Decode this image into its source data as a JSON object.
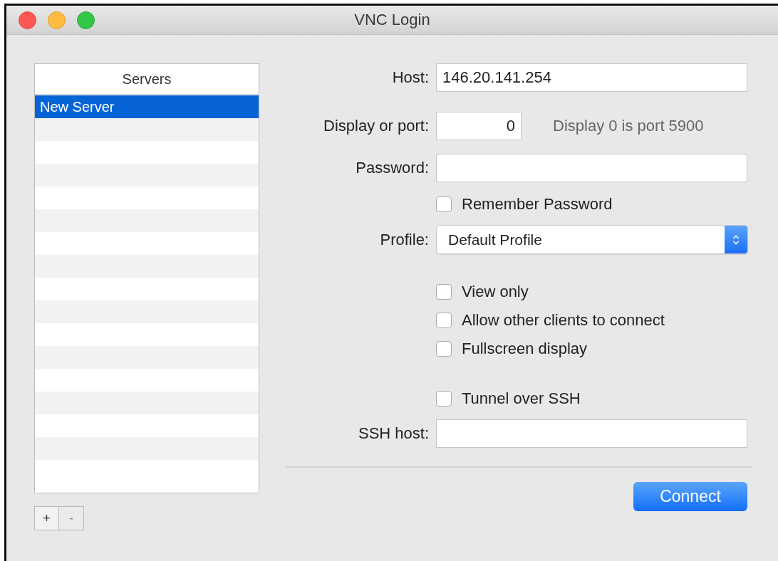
{
  "window": {
    "title": "VNC Login"
  },
  "servers": {
    "header": "Servers",
    "items": [
      {
        "label": "New Server",
        "selected": true
      }
    ]
  },
  "list_buttons": [
    {
      "label": "+",
      "disabled": false
    },
    {
      "label": "-",
      "disabled": true
    }
  ],
  "form": {
    "host": {
      "label": "Host:",
      "value": "146.20.141.254"
    },
    "display": {
      "label": "Display or port:",
      "value": "0",
      "note": "Display 0 is port 5900"
    },
    "password": {
      "label": "Password:"
    },
    "remember_password": {
      "label": "Remember Password",
      "checked": false
    },
    "profile": {
      "label": "Profile:",
      "value": "Default Profile"
    },
    "options": [
      {
        "label": "View only",
        "checked": false
      },
      {
        "label": "Allow other clients to connect",
        "checked": false
      },
      {
        "label": "Fullscreen display",
        "checked": false
      }
    ],
    "tunnel_ssh": {
      "label": "Tunnel over SSH",
      "checked": false
    },
    "ssh_host": {
      "label": "SSH host:"
    }
  },
  "connect_button": "Connect"
}
